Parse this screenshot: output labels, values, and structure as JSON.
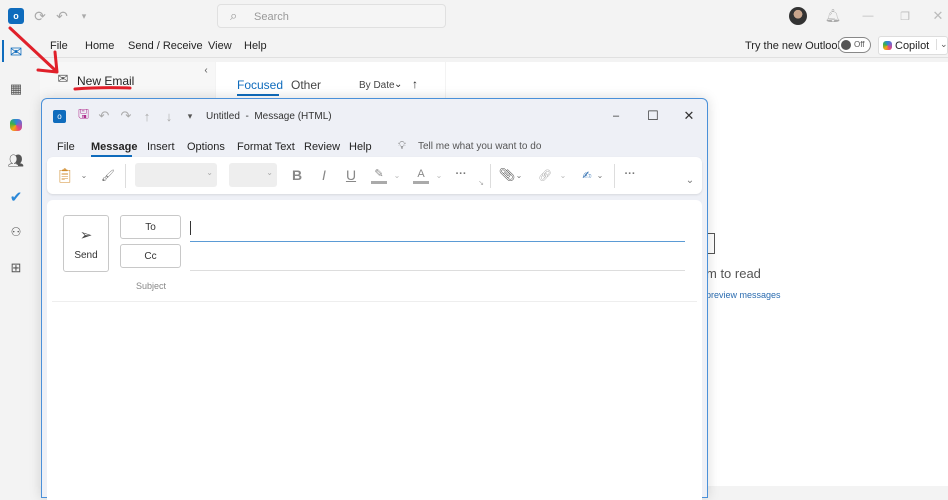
{
  "titlebar": {
    "search_placeholder": "Search"
  },
  "menu": {
    "items": [
      "File",
      "Home",
      "Send / Receive",
      "View",
      "Help"
    ],
    "try_new": "Try the new Outlook",
    "toggle": "Off",
    "copilot": "Copilot"
  },
  "folder_pane": {
    "new_email": "New Email"
  },
  "list": {
    "tab_focused": "Focused",
    "tab_other": "Other",
    "sort": "By Date"
  },
  "reading": {
    "title_partial": "m to read",
    "link_partial": "preview messages"
  },
  "compose": {
    "title": "Untitled  -  Message (HTML)",
    "tabs": [
      "File",
      "Message",
      "Insert",
      "Options",
      "Format Text",
      "Review",
      "Help"
    ],
    "tell_me": "Tell me what you want to do",
    "send": "Send",
    "to": "To",
    "cc": "Cc",
    "subject": "Subject"
  },
  "colors": {
    "accent": "#0f6cbd",
    "annotation": "#e0202a"
  }
}
